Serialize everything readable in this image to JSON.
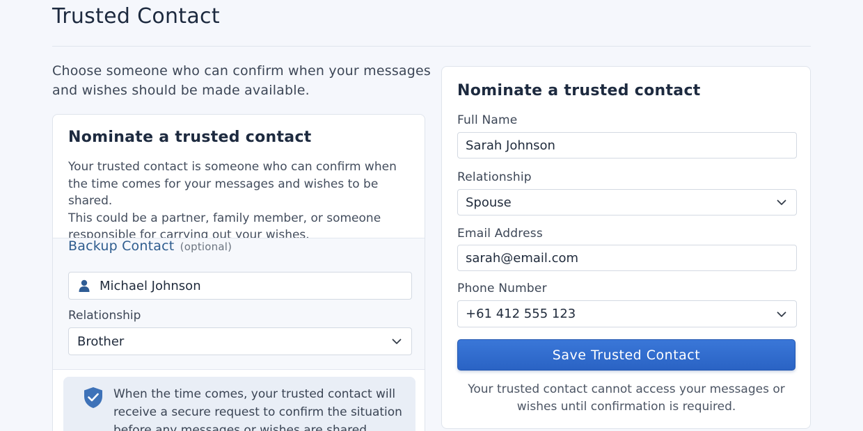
{
  "page": {
    "title": "Trusted Contact",
    "intro": "Choose someone who can confirm when your messages and wishes should be made available."
  },
  "left_card": {
    "heading": "Nominate a trusted contact",
    "description_1": "Your trusted contact is someone who can confirm when the time comes for your messages and wishes to be shared.",
    "description_2": "This could be a partner, family member, or someone responsible for carrying out your wishes.",
    "backup": {
      "title": "Backup Contact",
      "optional": "(optional)",
      "name_value": "Michael Johnson",
      "name_icon": "person-icon",
      "relationship_label": "Relationship",
      "relationship_value": "Brother"
    },
    "notice": {
      "icon": "shield-check-icon",
      "text": "When the time comes, your trusted contact will receive a secure request to confirm the situation before any messages or wishes are shared."
    }
  },
  "right_card": {
    "heading": "Nominate a trusted contact",
    "full_name_label": "Full Name",
    "full_name_value": "Sarah Johnson",
    "relationship_label": "Relationship",
    "relationship_value": "Spouse",
    "email_label": "Email Address",
    "email_value": "sarah@email.com",
    "phone_label": "Phone Number",
    "phone_value": "+61 412 555 123",
    "save_label": "Save Trusted Contact",
    "footnote": "Your trusted contact cannot access your messages or wishes until confirmation is required."
  },
  "colors": {
    "accent": "#2f6bcf",
    "backup_title": "#2e5c8e",
    "background": "#f5f7fc"
  }
}
